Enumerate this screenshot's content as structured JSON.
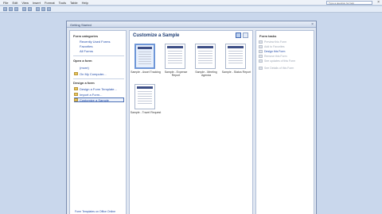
{
  "menu": [
    "File",
    "Edit",
    "View",
    "Insert",
    "Format",
    "Tools",
    "Table",
    "Help"
  ],
  "help_placeholder": "Type a question for help",
  "dialog": {
    "title": "Getting Started",
    "left": {
      "form_categories_title": "Form categories",
      "categories": [
        "Recently Used Forms",
        "Favorites",
        "All Forms"
      ],
      "open_form_title": "Open a form",
      "open_items": [
        "(more)",
        "On My Computer..."
      ],
      "design_title": "Design a form",
      "design_items": [
        "Design a Form Template...",
        "Import a Form...",
        "Customize a Sample"
      ],
      "footer": "Form Templates on Office Online"
    },
    "center": {
      "title": "Customize a Sample",
      "samples": [
        "Sample - Asset Tracking",
        "Sample - Expense Report",
        "Sample - Meeting Agenda",
        "Sample - Status Report",
        "Sample - Travel Request"
      ]
    },
    "right": {
      "title": "Form tasks",
      "tasks": [
        {
          "label": "Preview this Form",
          "enabled": false
        },
        {
          "label": "Add to Favorites",
          "enabled": false
        },
        {
          "label": "Design this Form",
          "enabled": true
        },
        {
          "label": "Remove this Form",
          "enabled": false
        },
        {
          "label": "See updates of this Form",
          "enabled": false
        },
        {
          "label": "See Details of this Form",
          "enabled": false
        }
      ]
    }
  }
}
